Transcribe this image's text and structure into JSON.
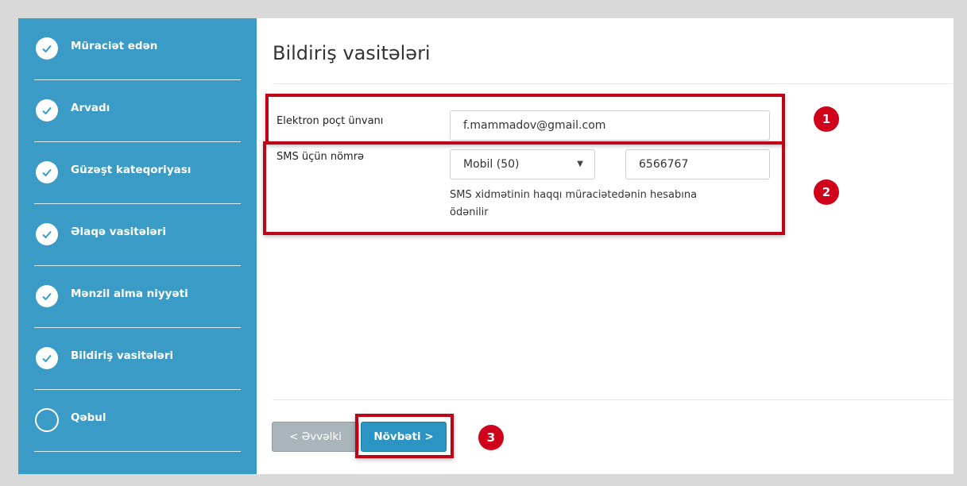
{
  "sidebar": {
    "steps": [
      {
        "label": "Müraciət edən",
        "state": "done"
      },
      {
        "label": "Arvadı",
        "state": "done"
      },
      {
        "label": "Güzəşt kateqoriyası",
        "state": "done"
      },
      {
        "label": "Əlaqə vasitələri",
        "state": "done"
      },
      {
        "label": "Mənzil alma niyyəti",
        "state": "done"
      },
      {
        "label": "Bildiriş vasitələri",
        "state": "done"
      },
      {
        "label": "Qəbul",
        "state": "pending"
      }
    ]
  },
  "main": {
    "title": "Bildiriş vasitələri",
    "email": {
      "label": "Elektron poçt ünvanı",
      "value": "f.mammadov@gmail.com"
    },
    "sms": {
      "label": "SMS üçün nömrə",
      "operator_selected": "Mobil (50)",
      "number": "6566767",
      "note": "SMS xidmətinin haqqı müraciətedənin hesabına ödənilir"
    }
  },
  "footer": {
    "prev_label": "<  Əvvəlki",
    "next_label": "Növbəti  >"
  },
  "annotations": [
    "1",
    "2",
    "3"
  ],
  "colors": {
    "sidebar_bg": "#3a9bc6",
    "accent_red": "#d0021b",
    "next_button": "#2b94c3",
    "prev_button": "#a9b4bb"
  }
}
